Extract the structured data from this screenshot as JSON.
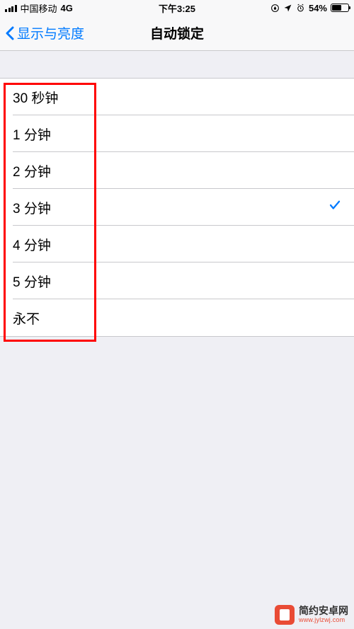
{
  "status": {
    "carrier": "中国移动",
    "network": "4G",
    "time": "下午3:25",
    "battery_pct": "54%"
  },
  "nav": {
    "back_label": "显示与亮度",
    "title": "自动锁定"
  },
  "options": [
    {
      "label": "30 秒钟",
      "selected": false
    },
    {
      "label": "1 分钟",
      "selected": false
    },
    {
      "label": "2 分钟",
      "selected": false
    },
    {
      "label": "3 分钟",
      "selected": true
    },
    {
      "label": "4 分钟",
      "selected": false
    },
    {
      "label": "5 分钟",
      "selected": false
    },
    {
      "label": "永不",
      "selected": false
    }
  ],
  "watermark": {
    "title": "简约安卓网",
    "url": "www.jylzwj.com"
  },
  "colors": {
    "accent": "#007aff",
    "highlight_border": "#ff0000",
    "watermark_badge": "#e94b35"
  }
}
